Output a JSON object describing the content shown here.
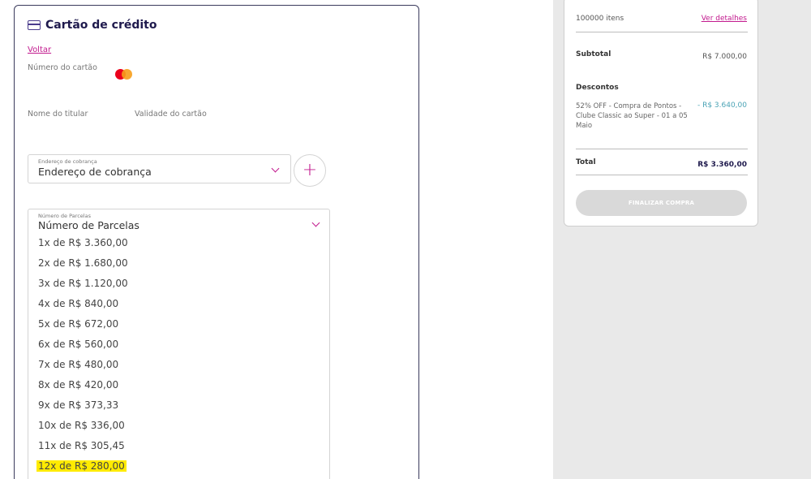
{
  "payment": {
    "title": "Cartão de crédito",
    "back_label": "Voltar",
    "card_number_label": "Número do cartão",
    "holder_name_label": "Nome do titular",
    "expiry_label": "Validade do cartão",
    "billing": {
      "mini_label": "Endereço de cobrança",
      "value": "Endereço de cobrança"
    },
    "add_label": "+",
    "installments": {
      "mini_label": "Número de Parcelas",
      "value": "Número de Parcelas",
      "options": [
        "1x de R$ 3.360,00",
        "2x de R$ 1.680,00",
        "3x de R$ 1.120,00",
        "4x de R$ 840,00",
        "5x de R$ 672,00",
        "6x de R$ 560,00",
        "7x de R$ 480,00",
        "8x de R$ 420,00",
        "9x de R$ 373,33",
        "10x de R$ 336,00",
        "11x de R$ 305,45",
        "12x de R$ 280,00"
      ],
      "highlighted_option": "12x de R$ 280,00"
    }
  },
  "summary": {
    "items_count": "100000 itens",
    "details_link": "Ver detalhes",
    "subtotal_label": "Subtotal",
    "subtotal_value": "R$ 7.000,00",
    "discounts_label": "Descontos",
    "discount_desc": "52% OFF - Compra de Pontos - Clube Classic ao Super - 01 a 05 Maio",
    "discount_value": "- R$ 3.640,00",
    "total_label": "Total",
    "total_value": "R$ 3.360,00",
    "finalize_label": "FINALIZAR COMPRA"
  },
  "colors": {
    "accent": "#c21a8e",
    "highlight": "#ffeb00",
    "title": "#1f1a4d",
    "discount": "#4aa3b5",
    "button_disabled": "#d9d9d9"
  }
}
